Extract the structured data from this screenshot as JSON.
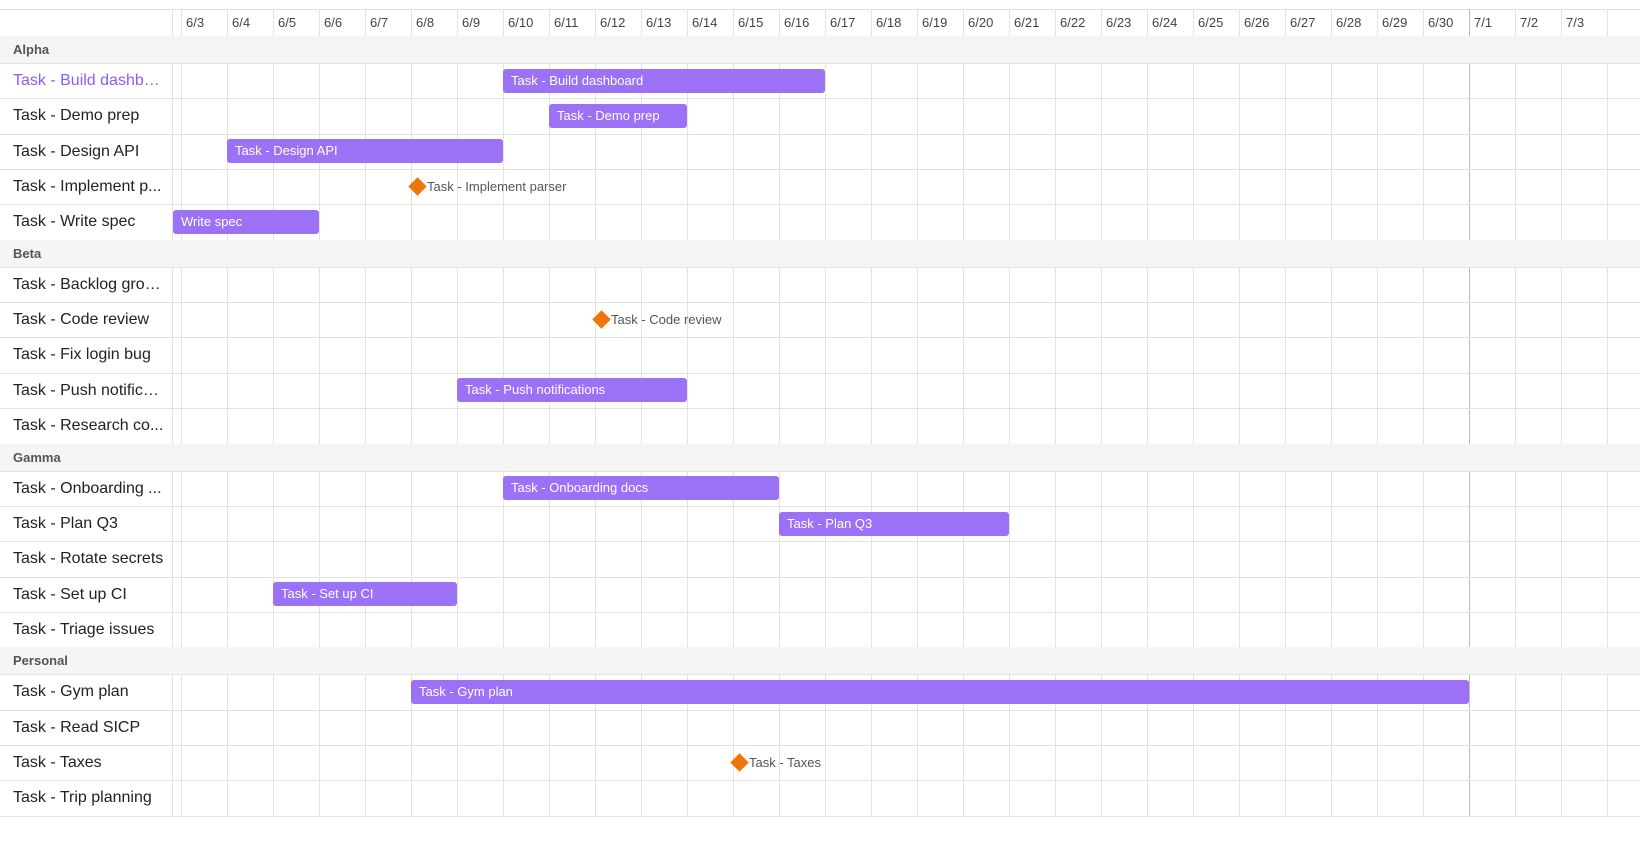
{
  "colors": {
    "bar": "#9b72f5",
    "milestone": "#ef7508",
    "selected_text": "#8a5cf5",
    "group_bg": "#f5f5f5"
  },
  "timeline": {
    "dates": [
      "6/3",
      "6/4",
      "6/5",
      "6/6",
      "6/7",
      "6/8",
      "6/9",
      "6/10",
      "6/11",
      "6/12",
      "6/13",
      "6/14",
      "6/15",
      "6/16",
      "6/17",
      "6/18",
      "6/19",
      "6/20",
      "6/21",
      "6/22",
      "6/23",
      "6/24",
      "6/25",
      "6/26",
      "6/27",
      "6/28",
      "6/29",
      "6/30",
      "7/1",
      "7/2",
      "7/3"
    ],
    "month_boundary": "7/1"
  },
  "groups": [
    {
      "name": "Alpha",
      "tasks": [
        {
          "label": "Task - Build dashbo...",
          "selected": true,
          "bar": {
            "type": "bar",
            "start": "6/10",
            "end": "6/17",
            "text": "Task - Build dashboard"
          }
        },
        {
          "label": "Task - Demo prep",
          "bar": {
            "type": "bar",
            "start": "6/11",
            "end": "6/14",
            "text": "Task - Demo prep"
          }
        },
        {
          "label": "Task - Design API",
          "bar": {
            "type": "bar",
            "start": "6/4",
            "end": "6/10",
            "text": "Task - Design API"
          }
        },
        {
          "label": "Task - Implement p...",
          "bar": {
            "type": "milestone",
            "date": "6/8",
            "text": "Task - Implement parser"
          }
        },
        {
          "label": "Task - Write spec",
          "bar": {
            "type": "bar",
            "start": "6/2",
            "end": "6/6",
            "text": "Write spec"
          }
        }
      ]
    },
    {
      "name": "Beta",
      "tasks": [
        {
          "label": "Task - Backlog groo..."
        },
        {
          "label": "Task - Code review",
          "bar": {
            "type": "milestone",
            "date": "6/12",
            "text": "Task - Code review"
          }
        },
        {
          "label": "Task - Fix login bug"
        },
        {
          "label": "Task - Push notifica...",
          "bar": {
            "type": "bar",
            "start": "6/9",
            "end": "6/14",
            "text": "Task - Push notifications"
          }
        },
        {
          "label": "Task - Research co..."
        }
      ]
    },
    {
      "name": "Gamma",
      "tasks": [
        {
          "label": "Task - Onboarding ...",
          "bar": {
            "type": "bar",
            "start": "6/10",
            "end": "6/16",
            "text": "Task - Onboarding docs"
          }
        },
        {
          "label": "Task - Plan Q3",
          "bar": {
            "type": "bar",
            "start": "6/16",
            "end": "6/21",
            "text": "Task - Plan Q3"
          }
        },
        {
          "label": "Task - Rotate secrets"
        },
        {
          "label": "Task - Set up CI",
          "bar": {
            "type": "bar",
            "start": "6/5",
            "end": "6/9",
            "text": "Task - Set up CI"
          }
        },
        {
          "label": "Task - Triage issues"
        }
      ]
    },
    {
      "name": "Personal",
      "tasks": [
        {
          "label": "Task - Gym plan",
          "bar": {
            "type": "bar",
            "start": "6/8",
            "end": "7/1",
            "text": "Task - Gym plan"
          }
        },
        {
          "label": "Task - Read SICP"
        },
        {
          "label": "Task - Taxes",
          "bar": {
            "type": "milestone",
            "date": "6/15",
            "text": "Task - Taxes"
          }
        },
        {
          "label": "Task - Trip planning"
        }
      ]
    }
  ]
}
